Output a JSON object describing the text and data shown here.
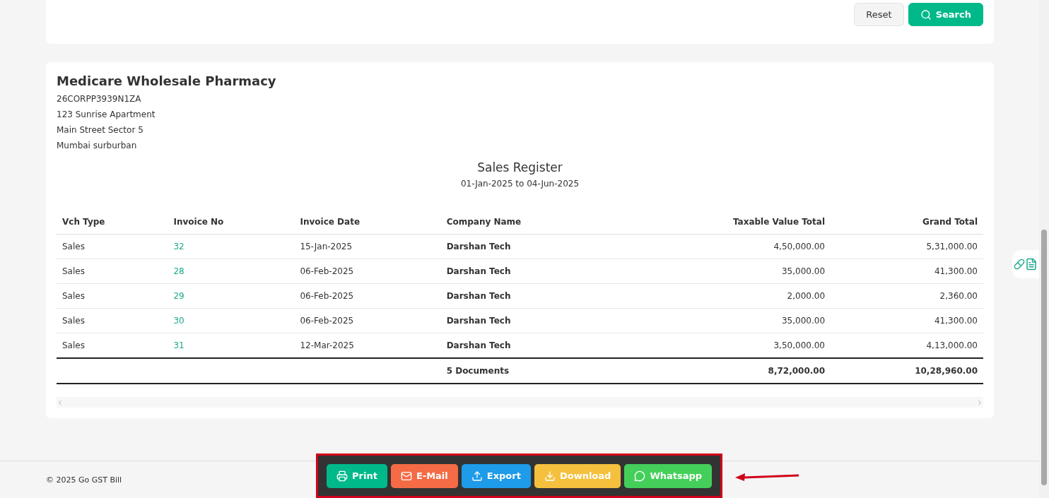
{
  "filter_actions": [
    {
      "kind": "reset",
      "label": "Reset"
    },
    {
      "kind": "search",
      "label": "Search"
    }
  ],
  "company": {
    "name": "Medicare Wholesale Pharmacy",
    "lines": [
      "26CORPP3939N1ZA",
      "123 Sunrise Apartment",
      "Main Street Sector 5",
      "Mumbai surburban"
    ]
  },
  "report": {
    "title": "Sales Register",
    "period": "01-Jan-2025 to 04-Jun-2025"
  },
  "table": {
    "columns": [
      "Vch Type",
      "Invoice No",
      "Invoice Date",
      "Company Name",
      "Taxable Value Total",
      "Grand Total"
    ],
    "rows": [
      [
        "Sales",
        "32",
        "15-Jan-2025",
        "Darshan Tech",
        "4,50,000.00",
        "5,31,000.00"
      ],
      [
        "Sales",
        "28",
        "06-Feb-2025",
        "Darshan Tech",
        "35,000.00",
        "41,300.00"
      ],
      [
        "Sales",
        "29",
        "06-Feb-2025",
        "Darshan Tech",
        "2,000.00",
        "2,360.00"
      ],
      [
        "Sales",
        "30",
        "06-Feb-2025",
        "Darshan Tech",
        "35,000.00",
        "41,300.00"
      ],
      [
        "Sales",
        "31",
        "12-Mar-2025",
        "Darshan Tech",
        "3,50,000.00",
        "4,13,000.00"
      ]
    ],
    "totals": {
      "documents": "5 Documents",
      "taxable_value_total": "8,72,000.00",
      "grand_total": "10,28,960.00"
    }
  },
  "footer": {
    "copyright": "© 2025 Go GST Bill"
  },
  "share_actions": [
    {
      "kind": "print",
      "label": "Print"
    },
    {
      "kind": "email",
      "label": "E-Mail"
    },
    {
      "kind": "export",
      "label": "Export"
    },
    {
      "kind": "download",
      "label": "Download"
    },
    {
      "kind": "whatsapp",
      "label": "Whatsapp"
    }
  ]
}
